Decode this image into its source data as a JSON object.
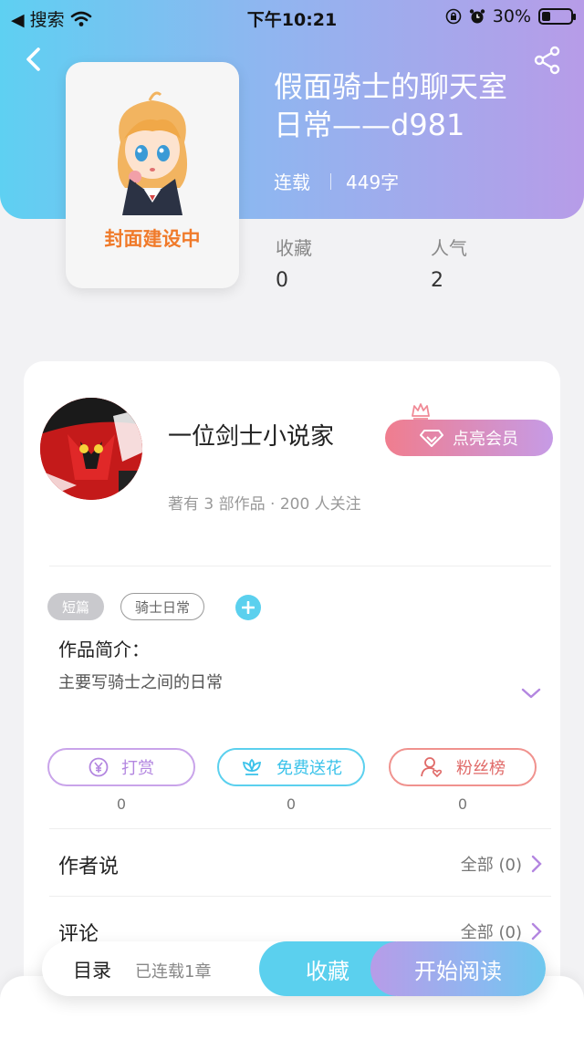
{
  "status_bar": {
    "back_app": "◀ 搜索",
    "time": "下午10:21",
    "battery": "30%",
    "battery_level": 0.3
  },
  "cover": {
    "text": "封面建设中"
  },
  "book": {
    "title_line1": "假面骑士的聊天室",
    "title_line2": "日常——d981",
    "status": "连载",
    "word_count": "449字"
  },
  "stats": [
    {
      "label": "收藏",
      "value": "0"
    },
    {
      "label": "人气",
      "value": "2"
    }
  ],
  "author": {
    "name": "一位剑士小说家",
    "sub": "著有 3 部作品 · 200 人关注",
    "vip_label": "点亮会员"
  },
  "tags": [
    "短篇",
    "骑士日常"
  ],
  "intro": {
    "title": "作品简介：",
    "text": "主要写骑士之间的日常"
  },
  "actions": [
    {
      "label": "打赏",
      "count": "0",
      "icon": "yen-coin-icon"
    },
    {
      "label": "免费送花",
      "count": "0",
      "icon": "flower-icon"
    },
    {
      "label": "粉丝榜",
      "count": "0",
      "icon": "user-heart-icon"
    }
  ],
  "sections": [
    {
      "title": "作者说",
      "right": "全部 (0)"
    },
    {
      "title": "评论",
      "right": "全部 (0)"
    }
  ],
  "bottom_bar": {
    "toc": "目录",
    "chapters": "已连载1章",
    "collect": "收藏",
    "read": "开始阅读"
  },
  "colors": {
    "header_left": "#5ed0f2",
    "header_right": "#b79ce8",
    "accent_cyan": "#5bd0ee",
    "cover_text": "#f07a2a",
    "vip_gradient_start": "#f07d8e"
  }
}
